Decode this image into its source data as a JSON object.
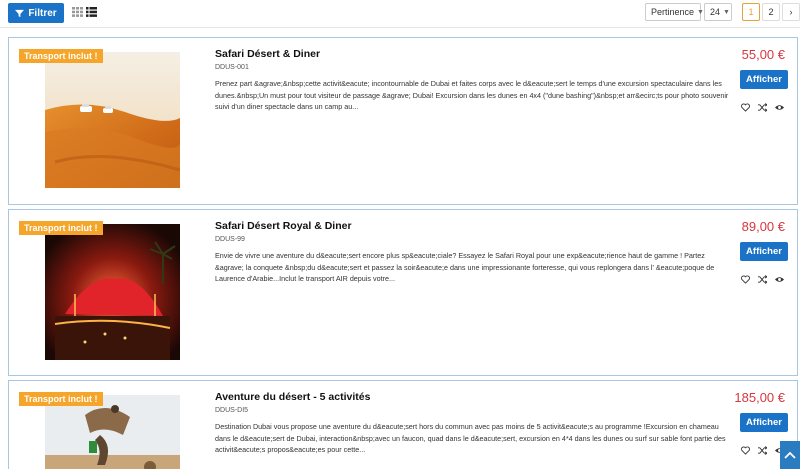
{
  "toolbar": {
    "filter_label": "Filtrer",
    "sort_value": "Pertinence",
    "page_size_value": "24",
    "pages": [
      "1",
      "2"
    ],
    "next_label": "›"
  },
  "products": [
    {
      "badge": "Transport inclut !",
      "title": "Safari Désert & Diner",
      "code": "DDUS-001",
      "description": "Prenez part &agrave;&nbsp;cette activit&eacute; incontournable de Dubai et faites corps avec le d&eacute;sert le temps d'une excursion spectaculaire dans les dunes.&nbsp;Un must pour tout visiteur de passage &agrave; Dubai! Excursion dans les dunes en 4x4 (\"dune bashing\")&nbsp;et arr&ecirc;ts pour photo souvenir suivi d'un diner spectacle dans un camp au...",
      "price": "55,00 €",
      "button": "Afficher"
    },
    {
      "badge": "Transport inclut !",
      "title": "Safari Désert Royal & Diner",
      "code": "DDUS-99",
      "description": "Envie de vivre une aventure du d&eacute;sert encore plus sp&eacute;ciale? Essayez le Safari Royal pour une exp&eacute;rience haut de gamme ! Partez &agrave; la conquete &nbsp;du d&eacute;sert et passez la soir&eacute;e dans une impressionante forteresse, qui vous replongera dans l' &eacute;poque de Laurence d'Arabie...Inclut le transport AIR depuis votre...",
      "price": "89,00 €",
      "button": "Afficher"
    },
    {
      "badge": "Transport inclut !",
      "title": "Aventure du désert - 5 activités",
      "code": "DDUS-DI5",
      "description": "Destination Dubai vous propose une aventure du d&eacute;sert hors du commun avec pas moins de 5 activit&eacute;s au programme !Excursion en chameau dans le d&eacute;sert de Dubai, interaction&nbsp;avec un faucon, quad dans le d&eacute;sert, excursion en 4*4 dans les dunes ou surf sur sable font partie des activit&eacute;s propos&eacute;es pour cette...",
      "price": "185,00 €",
      "button": "Afficher"
    }
  ],
  "colors": {
    "accent": "#1a73c7",
    "price": "#d7373f",
    "badge": "#f5a52a",
    "card_border": "#a9c7e3"
  },
  "icons": [
    "filter-icon",
    "grid-view-icon",
    "list-view-icon",
    "heart-icon",
    "shuffle-icon",
    "eye-icon",
    "chevron-up-icon"
  ]
}
